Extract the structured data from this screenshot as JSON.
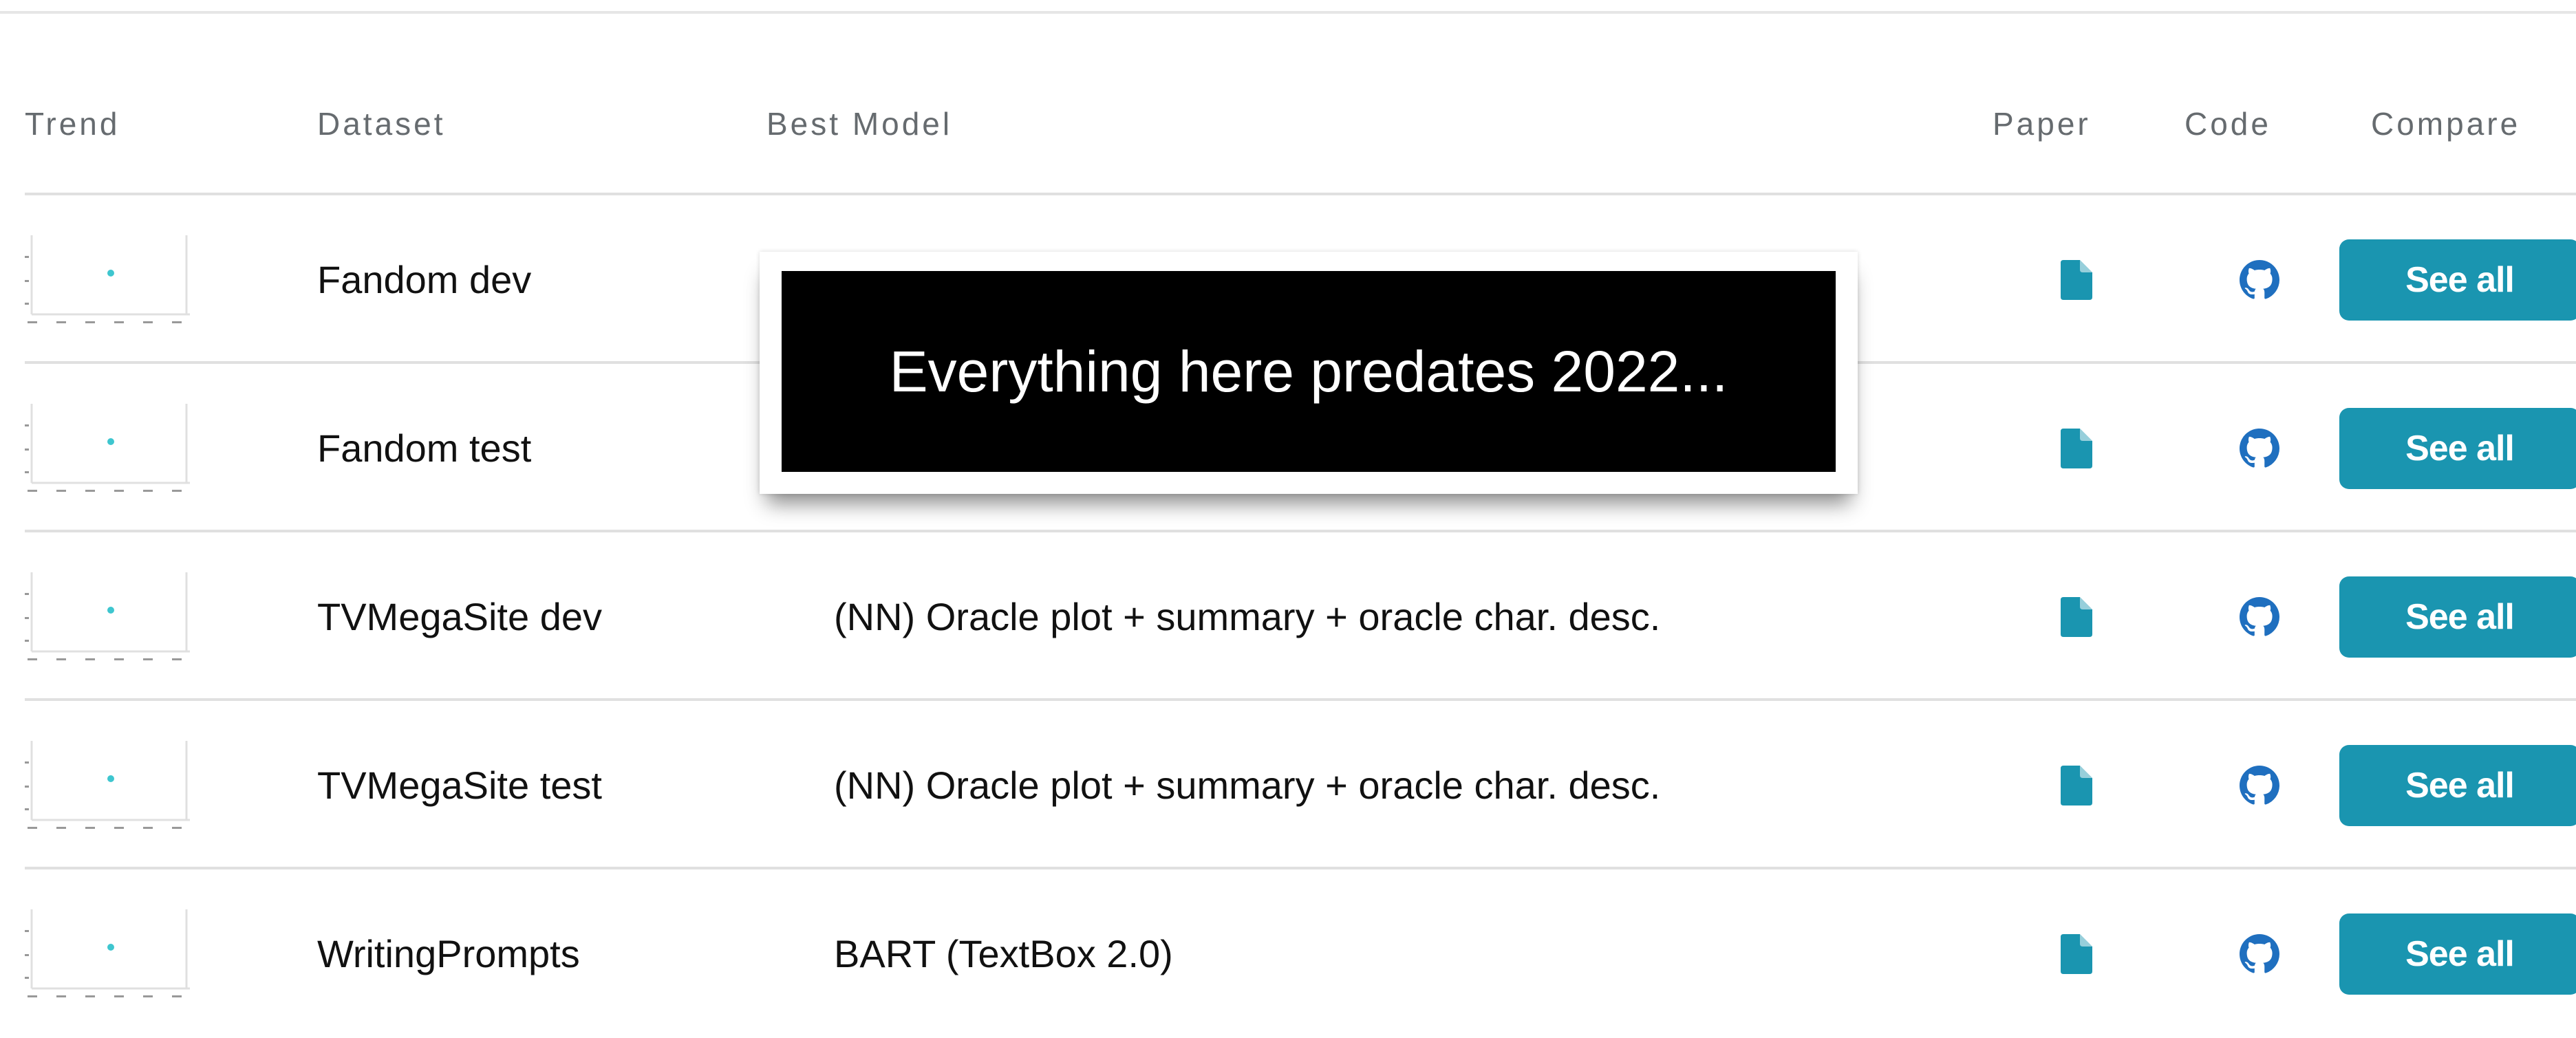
{
  "header": {
    "trend": "Trend",
    "dataset": "Dataset",
    "best_model": "Best Model",
    "paper": "Paper",
    "code": "Code",
    "compare": "Compare"
  },
  "rows": [
    {
      "dataset": "Fandom dev",
      "model": "",
      "button": "See all"
    },
    {
      "dataset": "Fandom test",
      "model": "",
      "button": "See all"
    },
    {
      "dataset": "TVMegaSite dev",
      "model": "(NN) Oracle plot + summary + oracle char. desc.",
      "button": "See all"
    },
    {
      "dataset": "TVMegaSite test",
      "model": "(NN) Oracle plot + summary + oracle char. desc.",
      "button": "See all"
    },
    {
      "dataset": "WritingPrompts",
      "model": "BART (TextBox 2.0)",
      "button": "See all"
    }
  ],
  "overlay": {
    "text": "Everything here predates 2022..."
  },
  "icons": {
    "paper": "paper-document-icon",
    "code": "github-icon",
    "trend": "sparkline-chart-icon"
  },
  "colors": {
    "accent": "#1a95b0",
    "icon": "#1a95b0",
    "code_icon": "#1f6fbf",
    "trend_point": "#3ec6cf"
  }
}
